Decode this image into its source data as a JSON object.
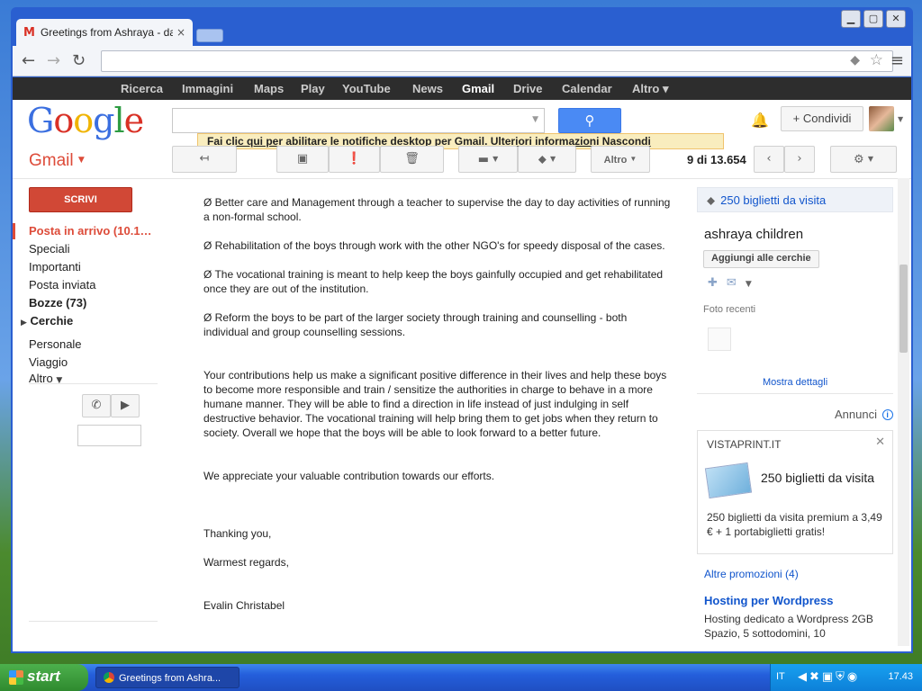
{
  "browser": {
    "tab_title": "Greetings from Ashraya - dal",
    "tab_close": "×"
  },
  "gbar": {
    "items": [
      "Ricerca",
      "Immagini",
      "Maps",
      "Play",
      "YouTube",
      "News",
      "Gmail",
      "Drive",
      "Calendar",
      "Altro ▾"
    ]
  },
  "header": {
    "logo_letters": [
      "G",
      "o",
      "o",
      "g",
      "l",
      "e"
    ],
    "share_label": "+ Condividi"
  },
  "notification": {
    "enable_link": "Fai clic qui per abilitare",
    "text": " le notifiche desktop per Gmail. ",
    "more_link": "Ulteriori informazioni",
    "hide_link": "Nascondi"
  },
  "toolbar": {
    "gmail_label": "Gmail",
    "more_label": "Altro",
    "count": "9 di 13.654"
  },
  "sidebar": {
    "compose": "SCRIVI",
    "items": [
      "Posta in arrivo (10.1…",
      "Speciali",
      "Importanti",
      "Posta inviata",
      "Bozze (73)",
      "Cerchie",
      "Personale",
      "Viaggio",
      "Altro"
    ]
  },
  "message": {
    "paragraphs": [
      "Ø  Better care and Management through a teacher to supervise the day to day activities of running a non-formal school.",
      "Ø  Rehabilitation of the boys through work with the other NGO's for speedy disposal of the cases.",
      "Ø  The vocational training is meant to help keep the boys gainfully occupied and get rehabilitated once they are out of the institution.",
      "Ø  Reform the boys to be part of the larger society through training and counselling - both individual and group counselling sessions.",
      "Your contributions help us make a significant positive difference in their lives and help these boys to become more responsible and train / sensitize the authorities in charge to behave in a more humane manner. They will be able to find a direction in life instead of just indulging in self destructive behavior. The vocational training will help bring them to get jobs when they return to society. Overall we hope that the boys will be able to look forward to a better future.",
      "We appreciate your valuable contribution towards our efforts.",
      "Thanking you,",
      "Warmest regards,",
      "Evalin Christabel"
    ]
  },
  "right_panel": {
    "label": "250 biglietti da visita",
    "contact_name": "ashraya children",
    "add_circles": "Aggiungi alle cerchie",
    "recent_photos": "Foto recenti",
    "show_details": "Mostra dettagli",
    "ads_label": "Annunci",
    "ad": {
      "advertiser": "VISTAPRINT.IT",
      "product": "250 biglietti da visita",
      "description": "250 biglietti da visita premium a 3,49 € + 1 portabiglietti gratis!"
    },
    "more_promos": "Altre promozioni (4)",
    "promo2_title": "Hosting per Wordpress",
    "promo2_desc": "Hosting dedicato a Wordpress 2GB Spazio, 5 sottodomini, 10"
  },
  "taskbar": {
    "start": "start",
    "task_label": "Greetings from Ashra...",
    "lang": "IT",
    "clock": "17.43"
  }
}
